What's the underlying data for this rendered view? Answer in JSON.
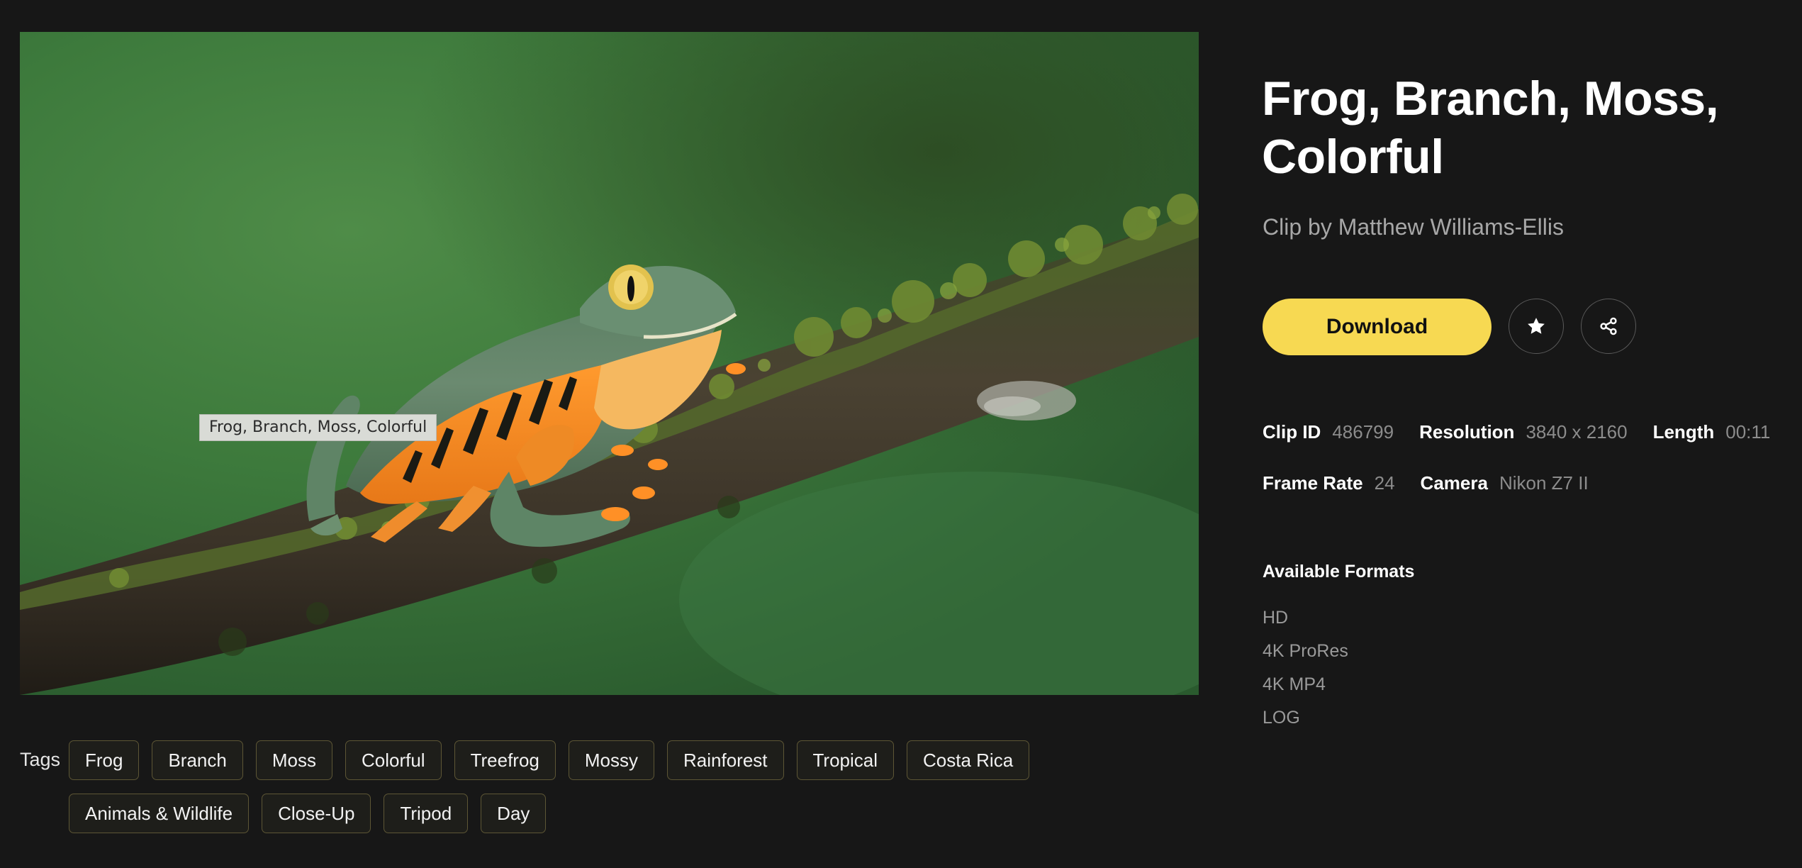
{
  "media": {
    "tooltip": "Frog, Branch, Moss, Colorful"
  },
  "clip": {
    "title": "Frog, Branch, Moss, Colorful",
    "byline": "Clip by Matthew Williams-Ellis"
  },
  "actions": {
    "download_label": "Download",
    "favorite_icon": "star-icon",
    "share_icon": "share-icon"
  },
  "meta": {
    "row1": [
      {
        "key": "Clip ID",
        "value": "486799"
      },
      {
        "key": "Resolution",
        "value": "3840 x 2160"
      },
      {
        "key": "Length",
        "value": "00:11"
      }
    ],
    "row2": [
      {
        "key": "Frame Rate",
        "value": "24"
      },
      {
        "key": "Camera",
        "value": "Nikon Z7 II"
      }
    ]
  },
  "formats": {
    "title": "Available Formats",
    "items": [
      "HD",
      "4K ProRes",
      "4K MP4",
      "LOG"
    ]
  },
  "tags": {
    "label": "Tags",
    "row1": [
      "Frog",
      "Branch",
      "Moss",
      "Colorful",
      "Treefrog",
      "Mossy",
      "Rainforest",
      "Tropical",
      "Costa Rica"
    ],
    "row2": [
      "Animals & Wildlife",
      "Close-Up",
      "Tripod",
      "Day"
    ]
  },
  "colors": {
    "background": "#171717",
    "accent": "#f7d952",
    "tag_border": "#5d5635",
    "muted_text": "#8c8c8c"
  }
}
